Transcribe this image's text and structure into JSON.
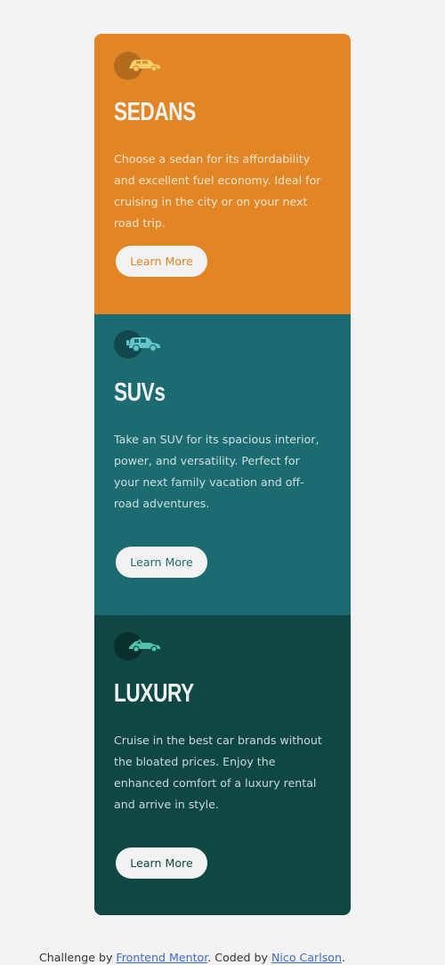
{
  "cards": [
    {
      "icon": "sedan-car-icon",
      "title": "SEDANS",
      "description": "Choose a sedan for its affordability and excellent fuel economy. Ideal for cruising in the city or on your next road trip.",
      "button_label": "Learn More",
      "accent": "#e28625"
    },
    {
      "icon": "suv-car-icon",
      "title": "SUVs",
      "description": "Take an SUV for its spacious interior, power, and versatility. Perfect for your next family vacation and off-road adventures.",
      "button_label": "Learn More",
      "accent": "#1c6b70"
    },
    {
      "icon": "luxury-car-icon",
      "title": "LUXURY",
      "description": "Cruise in the best car brands without the bloated prices. Enjoy the enhanced comfort of a luxury rental and arrive in style.",
      "button_label": "Learn More",
      "accent": "#0e4743"
    }
  ],
  "footer": {
    "prefix": "Challenge by ",
    "link1": "Frontend Mentor",
    "middle": ". Coded by ",
    "link2": "Nico Carlson",
    "suffix": "."
  },
  "colors": {
    "background": "#f2f2f2",
    "sedans": "#e28625",
    "suvs": "#1c6b70",
    "luxury": "#0e4743",
    "text_light": "#f2f2f2"
  }
}
